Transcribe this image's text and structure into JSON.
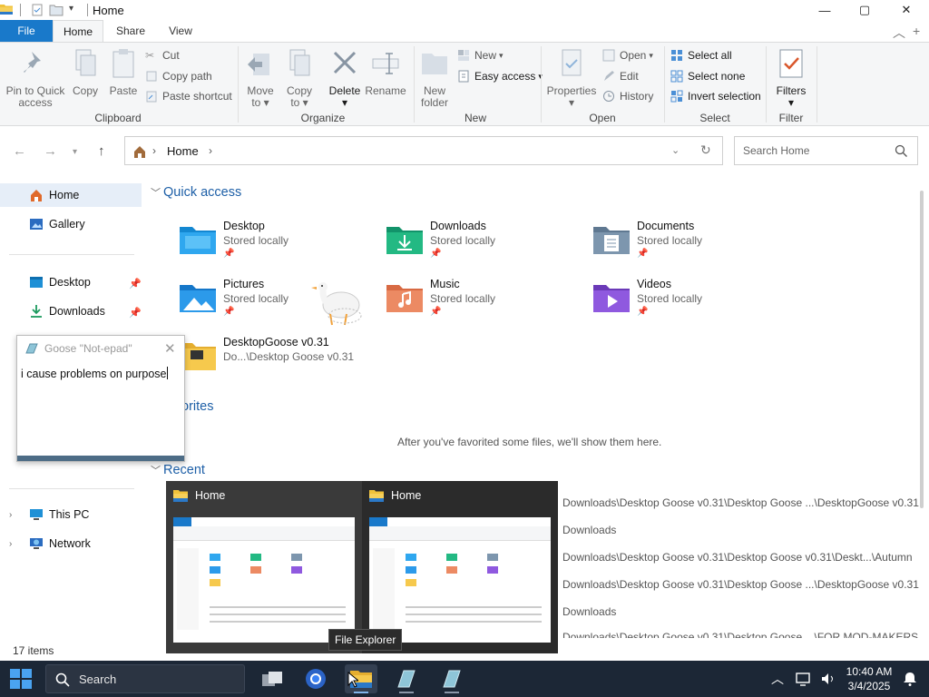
{
  "window": {
    "title": "Home",
    "controls": {
      "minimize": "—",
      "maximize": "▢",
      "close": "✕"
    }
  },
  "ribbon_tabs": [
    {
      "label": "File"
    },
    {
      "label": "Home"
    },
    {
      "label": "Share"
    },
    {
      "label": "View"
    }
  ],
  "ribbon": {
    "clipboard": {
      "group_label": "Clipboard",
      "pin_label_1": "Pin to Quick",
      "pin_label_2": "access",
      "copy_label": "Copy",
      "paste_label": "Paste",
      "cut_label": "Cut",
      "copy_path_label": "Copy path",
      "paste_shortcut_label": "Paste shortcut"
    },
    "organize": {
      "group_label": "Organize",
      "move_to_1": "Move",
      "move_to_2": "to",
      "copy_to_1": "Copy",
      "copy_to_2": "to",
      "delete_label": "Delete",
      "rename_label": "Rename"
    },
    "new": {
      "group_label": "New",
      "new_folder_1": "New",
      "new_folder_2": "folder",
      "new_item_label": "New",
      "easy_access_label": "Easy access"
    },
    "open": {
      "group_label": "Open",
      "properties_label": "Properties",
      "open_label": "Open",
      "edit_label": "Edit",
      "history_label": "History"
    },
    "select": {
      "group_label": "Select",
      "select_all_label": "Select all",
      "select_none_label": "Select none",
      "invert_label": "Invert selection"
    },
    "filters": {
      "group_label": "Filter",
      "filters_label": "Filters"
    }
  },
  "address": {
    "crumb": "Home",
    "search_placeholder": "Search Home"
  },
  "nav_pane": {
    "home": "Home",
    "gallery": "Gallery",
    "desktop": "Desktop",
    "downloads": "Downloads",
    "this_pc": "This PC",
    "network": "Network"
  },
  "content": {
    "quick_access_header": "Quick access",
    "favorites_header": "orites",
    "favorites_empty": "After you've favorited some files, we'll show them here.",
    "recent_header": "Recent",
    "quick_access": [
      {
        "name": "Desktop",
        "sub": "Stored locally"
      },
      {
        "name": "Downloads",
        "sub": "Stored locally"
      },
      {
        "name": "Documents",
        "sub": "Stored locally"
      },
      {
        "name": "Pictures",
        "sub": "Stored locally"
      },
      {
        "name": "Music",
        "sub": "Stored locally"
      },
      {
        "name": "Videos",
        "sub": "Stored locally"
      },
      {
        "name": "DesktopGoose v0.31",
        "sub": "Do...\\Desktop Goose v0.31"
      }
    ],
    "recent": [
      "Downloads\\Desktop Goose v0.31\\Desktop Goose ...\\DesktopGoose v0.31",
      "Downloads",
      "Downloads\\Desktop Goose v0.31\\Desktop Goose v0.31\\Deskt...\\Autumn",
      "Downloads\\Desktop Goose v0.31\\Desktop Goose ...\\DesktopGoose v0.31",
      "Downloads",
      "Downloads\\Desktop Goose v0.31\\Desktop Goose ...\\FOR MOD-MAKERS"
    ]
  },
  "status": {
    "items": "17 items"
  },
  "notepad": {
    "title": "Goose \"Not-epad\"",
    "text": "i cause problems on purpose"
  },
  "thumbnails": [
    {
      "title": "Home"
    },
    {
      "title": "Home"
    }
  ],
  "tooltip": "File Explorer",
  "taskbar": {
    "search_placeholder": "Search",
    "time": "10:40 AM",
    "date": "3/4/2025"
  },
  "colors": {
    "accent": "#1979ca",
    "link_blue": "#1d5fa7",
    "taskbar": "#1c2736"
  }
}
